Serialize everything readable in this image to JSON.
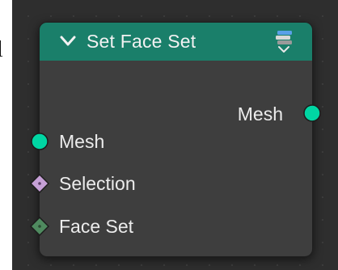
{
  "margin": {
    "glyph": "l"
  },
  "node": {
    "title": "Set Face Set",
    "header_color": "#1a7f6a",
    "icons": {
      "collapse": "chevron-down-icon",
      "type": "node-stack-icon"
    },
    "outputs": [
      {
        "label": "Mesh",
        "socket_color": "#00d6a3"
      }
    ],
    "inputs": [
      {
        "label": "Mesh",
        "socket_color": "#00d6a3",
        "shape": "circle"
      },
      {
        "label": "Selection",
        "socket_color": "#c6a0d6",
        "shape": "diamond"
      },
      {
        "label": "Face Set",
        "socket_color": "#4f8a5f",
        "shape": "diamond"
      }
    ]
  }
}
